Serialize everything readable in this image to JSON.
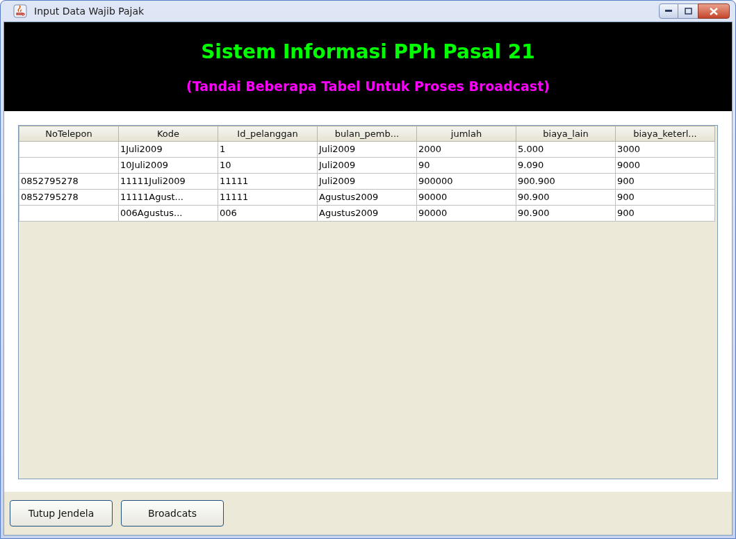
{
  "window": {
    "title": "Input Data Wajib Pajak"
  },
  "header": {
    "title": "Sistem Informasi PPh Pasal 21",
    "subtitle": "(Tandai Beberapa Tabel Untuk Proses Broadcast)"
  },
  "table": {
    "columns": [
      "NoTelepon",
      "Kode",
      "Id_pelanggan",
      "bulan_pemb...",
      "jumlah",
      "biaya_lain",
      "biaya_keterl..."
    ],
    "rows": [
      [
        "",
        "1Juli2009",
        "1",
        "Juli2009",
        "2000",
        "5.000",
        "3000"
      ],
      [
        "",
        "10Juli2009",
        "10",
        "Juli2009",
        "90",
        "9.090",
        "9000"
      ],
      [
        "0852795278",
        "11111Juli2009",
        "11111",
        "Juli2009",
        "900000",
        "900.900",
        "900"
      ],
      [
        "0852795278",
        "11111Agust...",
        "11111",
        "Agustus2009",
        "90000",
        "90.900",
        "900"
      ],
      [
        "",
        "006Agustus...",
        "006",
        "Agustus2009",
        "90000",
        "90.900",
        "900"
      ]
    ]
  },
  "buttons": [
    "Tutup Jendela",
    "Broadcats"
  ]
}
